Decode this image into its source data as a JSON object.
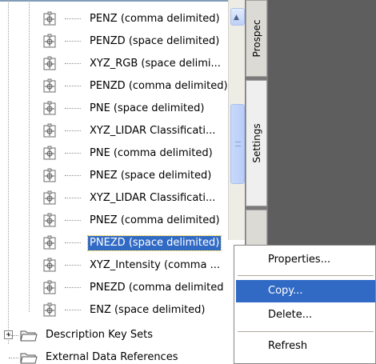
{
  "tree": {
    "items": [
      {
        "label": "PENZ (comma delimited)"
      },
      {
        "label": "PENZD (space delimited)"
      },
      {
        "label": "XYZ_RGB (space delimi..."
      },
      {
        "label": "PENZD (comma delimited)"
      },
      {
        "label": "PNE (space delimited)"
      },
      {
        "label": "XYZ_LIDAR Classificati..."
      },
      {
        "label": "PNE (comma delimited)"
      },
      {
        "label": "PNEZ (space delimited)"
      },
      {
        "label": "XYZ_LIDAR Classificati..."
      },
      {
        "label": "PNEZ (comma delimited)"
      },
      {
        "label": "PNEZD (space delimited)"
      },
      {
        "label": "XYZ_Intensity (comma ..."
      },
      {
        "label": "PNEZD (comma delimited"
      },
      {
        "label": "ENZ (space delimited)"
      }
    ],
    "selected_index": 10,
    "groups": [
      {
        "label": "Description Key Sets",
        "expander": "+"
      },
      {
        "label": "External Data References"
      }
    ]
  },
  "tabs": {
    "prospector": "Prospec",
    "settings": "Settings"
  },
  "context_menu": {
    "items": [
      {
        "label": "Properties..."
      },
      {
        "label": "Copy..."
      },
      {
        "label": "Delete..."
      },
      {
        "label": "Refresh"
      }
    ],
    "highlighted_index": 1
  },
  "colors": {
    "selection": "#316ac5",
    "panel_dark": "#5e5e5e"
  }
}
